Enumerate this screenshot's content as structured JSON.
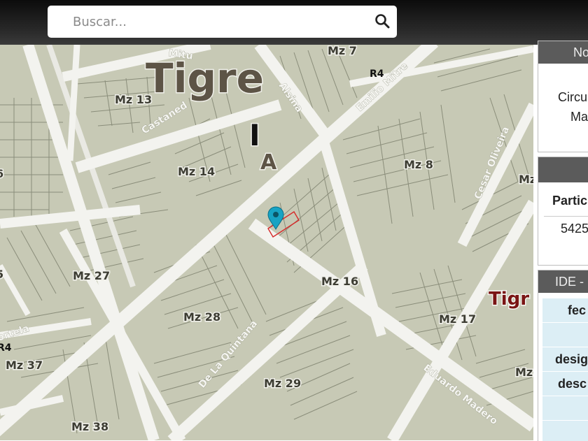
{
  "search": {
    "placeholder": "Buscar...",
    "icon": "search-icon"
  },
  "map": {
    "town_label": "Tigre",
    "district_labels": [
      "I",
      "A"
    ],
    "road_label": "R4",
    "road_label_left": "R4",
    "streets": [
      "Alsina",
      "Emilio Mitre",
      "Castaned",
      "Cesar Oliveira",
      "De La Quintana",
      "Eduardo Madero",
      "ortela",
      "Mitu"
    ],
    "blocks": [
      "Mz 7",
      "Mz 13",
      "Mz 14",
      "Mz 8",
      "Mz 27",
      "Mz 16",
      "Mz 28",
      "Mz 17",
      "Mz 37",
      "Mz 29",
      "Mz 38",
      "Mz",
      "Mz",
      "6",
      "5"
    ],
    "secondary_town_label": "Tigr",
    "marker_icon": "location-pin-icon",
    "colors": {
      "land": "#c7c9b5",
      "street": "#f3f3ef",
      "parcel_line": "#8a8d7a",
      "label": "#3d3d33",
      "town": "#5d5446",
      "highlight": "#d62a2a",
      "marker": "#17a3c4",
      "red_town": "#7a1414"
    }
  },
  "panel_top": {
    "header": "No",
    "line1": "Circu",
    "line2": "Ma"
  },
  "panel_mid": {
    "column": "Partic",
    "value": "5425"
  },
  "panel_bottom": {
    "header": "IDE -",
    "fields": [
      "fec",
      "",
      "desig",
      "desc",
      "",
      ""
    ]
  }
}
